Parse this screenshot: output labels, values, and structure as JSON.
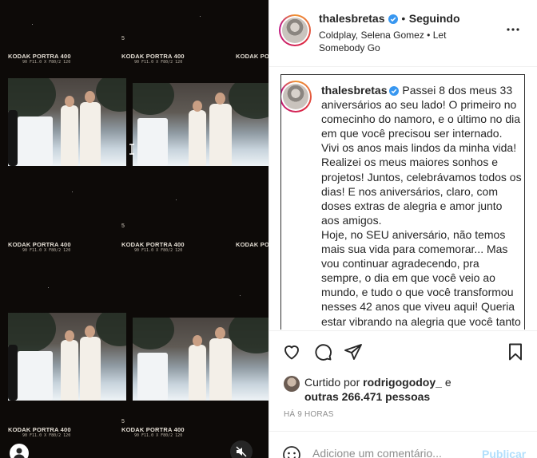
{
  "media": {
    "film_label": "KODAK PORTRA 400",
    "film_sub": "90 F11.0    X    F80/2 120",
    "frame_number": "5"
  },
  "post": {
    "username": "thalesbretas",
    "separator": "•",
    "follow_status": "Seguindo",
    "music": "Coldplay, Selena Gomez • Let Somebody Go",
    "caption_username": "thalesbretas",
    "caption": "Passei 8 dos meus 33 aniversários ao seu lado! O primeiro no comecinho do namoro, e o último no dia em que você precisou ser internado. Vivi os anos mais lindos da minha vida! Realizei os meus maiores sonhos e projetos! Juntos, celebrávamos todos os dias! E nos aniversários, claro, com doses extras de alegria e amor junto aos amigos.",
    "caption_2": "Hoje, no SEU aniversário, não temos mais sua vida para comemorar... Mas vou continuar agradecendo, pra sempre, o dia em que você veio ao mundo, e tudo o que você transformou nesses 42 anos que viveu aqui! Queria estar vibrando na alegria que você tanto",
    "likes_prefix": "Curtido por",
    "likes_user": "rodrigogodoy_",
    "likes_and": "e",
    "likes_others": "outras 266.471 pessoas",
    "timestamp": "HÁ 9 HORAS"
  },
  "comment": {
    "placeholder": "Adicione um comentário...",
    "publish_label": "Publicar"
  },
  "icons": {
    "verified": "verified-badge-icon",
    "more": "more-options-icon",
    "like": "heart-icon",
    "comment": "comment-bubble-icon",
    "share": "paper-plane-icon",
    "save": "bookmark-icon",
    "emoji": "emoji-icon",
    "mute": "muted-speaker-icon"
  },
  "colors": {
    "verified": "#3897f0",
    "publish": "#b2dffc",
    "muted_text": "#8e8e8e"
  }
}
